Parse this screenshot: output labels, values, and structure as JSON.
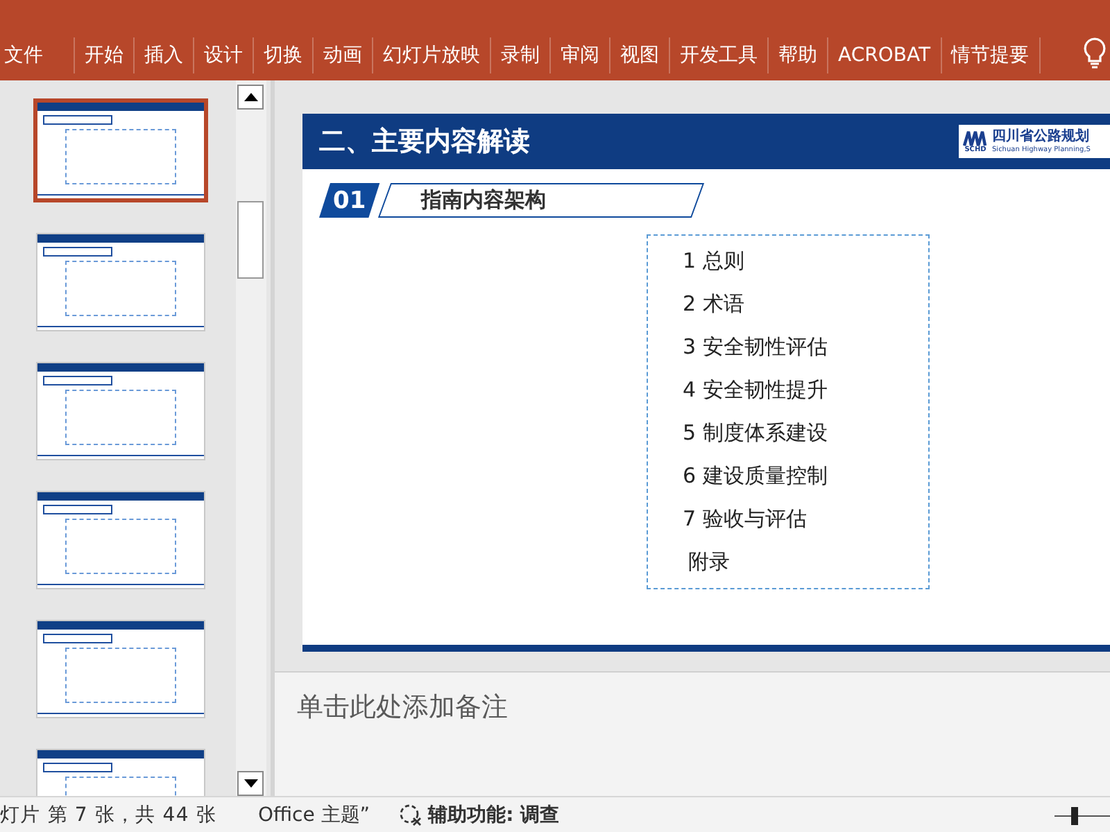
{
  "ribbon": {
    "tabs": [
      {
        "label": "文件"
      },
      {
        "label": "开始"
      },
      {
        "label": "插入"
      },
      {
        "label": "设计"
      },
      {
        "label": "切换"
      },
      {
        "label": "动画"
      },
      {
        "label": "幻灯片放映"
      },
      {
        "label": "录制"
      },
      {
        "label": "审阅"
      },
      {
        "label": "视图"
      },
      {
        "label": "开发工具"
      },
      {
        "label": "帮助"
      },
      {
        "label": "ACROBAT"
      },
      {
        "label": "情节提要"
      }
    ]
  },
  "thumbnails": [
    {
      "selected": true
    },
    {
      "selected": false
    },
    {
      "selected": false
    },
    {
      "selected": false
    },
    {
      "selected": false
    },
    {
      "selected": false
    }
  ],
  "slide": {
    "title": "二、主要内容解读",
    "logo": {
      "mark": "SCHD",
      "name": "四川省公路规划",
      "subtitle": "Sichuan Highway Planning,S"
    },
    "section": {
      "number": "01",
      "heading": "指南内容架构"
    },
    "toc": [
      "1 总则",
      "2 术语",
      "3 安全韧性评估",
      "4 安全韧性提升",
      "5 制度体系建设",
      "6 建设质量控制",
      "7 验收与评估",
      "附录"
    ]
  },
  "notes": {
    "placeholder": "单击此处添加备注"
  },
  "status_bar": {
    "slide_info": "灯片 第 7 张，共 44 张",
    "theme": "Office 主题”",
    "accessibility": "辅助功能: 调查",
    "zoom": {
      "level": 0.35
    }
  }
}
